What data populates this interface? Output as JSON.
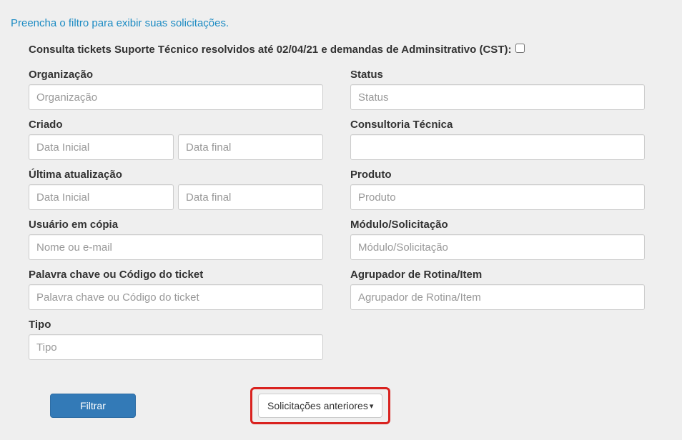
{
  "hint": "Preencha o filtro para exibir suas solicitações.",
  "cst": {
    "label": "Consulta tickets Suporte Técnico resolvidos até 02/04/21 e demandas de Adminsitrativo (CST):",
    "checked": false
  },
  "left": {
    "org": {
      "label": "Organização",
      "placeholder": "Organização"
    },
    "criado": {
      "label": "Criado",
      "ph_start": "Data Inicial",
      "ph_end": "Data final"
    },
    "atual": {
      "label": "Última atualização",
      "ph_start": "Data Inicial",
      "ph_end": "Data final"
    },
    "copia": {
      "label": "Usuário em cópia",
      "placeholder": "Nome ou e-mail"
    },
    "palavra": {
      "label": "Palavra chave ou Código do ticket",
      "placeholder": "Palavra chave ou Código do ticket"
    },
    "tipo": {
      "label": "Tipo",
      "placeholder": "Tipo"
    }
  },
  "right": {
    "status": {
      "label": "Status",
      "placeholder": "Status"
    },
    "consult": {
      "label": "Consultoria Técnica",
      "placeholder": ""
    },
    "produto": {
      "label": "Produto",
      "placeholder": "Produto"
    },
    "modulo": {
      "label": "Módulo/Solicitação",
      "placeholder": "Módulo/Solicitação"
    },
    "agrup": {
      "label": "Agrupador de Rotina/Item",
      "placeholder": "Agrupador de Rotina/Item"
    }
  },
  "actions": {
    "filtrar": "Filtrar",
    "anteriores": "Solicitações anteriores"
  }
}
